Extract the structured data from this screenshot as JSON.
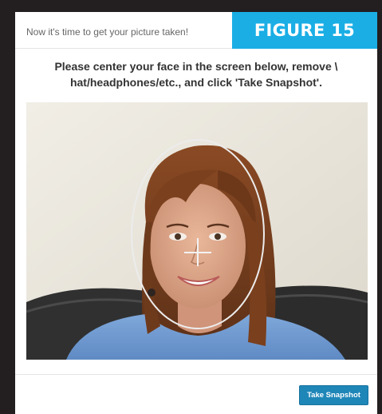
{
  "dialog": {
    "title": "Now it's time to get your picture taken!",
    "instructions": "Please center your face in the screen below, remove \\ hat/headphones/etc., and click 'Take Snapshot'.",
    "snapshot_label": "Take Snapshot"
  },
  "figure_badge": {
    "label": "FIGURE 15"
  },
  "camera": {
    "subject": "webcam-preview-face",
    "overlay": [
      "face-oval-guide",
      "crosshair"
    ]
  },
  "colors": {
    "badge": "#1aaee5",
    "button": "#1f86b8",
    "frame": "#231f20"
  }
}
